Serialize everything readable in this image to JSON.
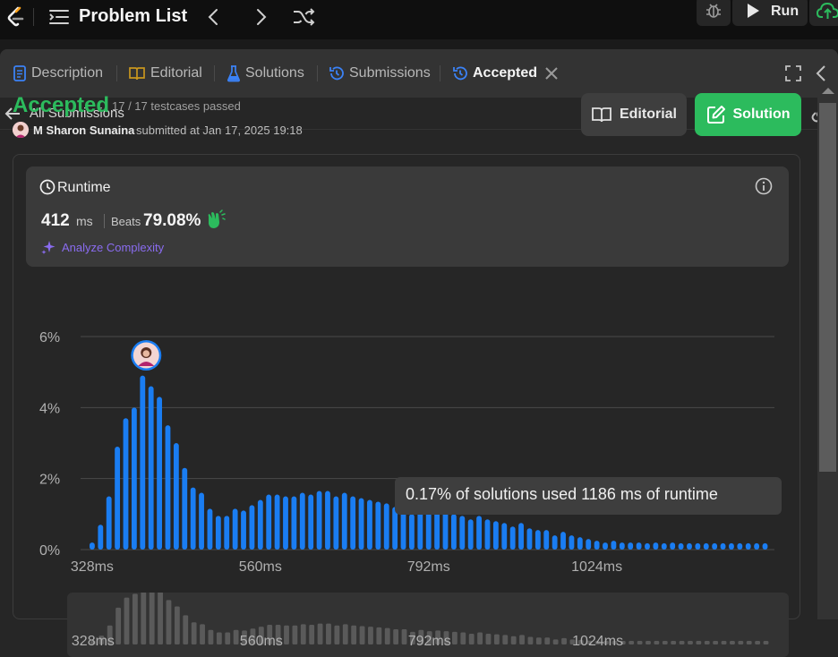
{
  "topbar": {
    "title": "Problem List",
    "run_label": "Run",
    "icons": [
      "leetcode-logo-icon",
      "list-icon",
      "chevron-left-icon",
      "chevron-right-icon",
      "shuffle-icon",
      "bug-icon",
      "play-icon",
      "cloud-upload-icon"
    ]
  },
  "tabs": [
    {
      "label": "Description",
      "icon": "description-icon"
    },
    {
      "label": "Editorial",
      "icon": "book-icon"
    },
    {
      "label": "Solutions",
      "icon": "flask-icon"
    },
    {
      "label": "Submissions",
      "icon": "history-icon"
    },
    {
      "label": "Accepted",
      "icon": "history-icon",
      "active": true
    }
  ],
  "subbar": {
    "back_label": "All Submissions"
  },
  "result": {
    "status": "Accepted",
    "testcases": "17 / 17 testcases passed",
    "author": "M Sharon Sunaina",
    "submitted": "submitted at Jan 17, 2025 19:18",
    "editorial_label": "Editorial",
    "solution_label": "Solution"
  },
  "runtime": {
    "title": "Runtime",
    "value": "412",
    "unit": "ms",
    "beats_label": "Beats",
    "beats_value": "79.08%",
    "analyze_label": "Analyze Complexity"
  },
  "tooltip": "0.17% of solutions used 1186 ms of runtime",
  "colors": {
    "accepted": "#2cbb5d",
    "bar": "#1a7df2",
    "analyze": "#8a6cf0",
    "brush_bar": "#5a5a5a"
  },
  "chart_data": {
    "type": "bar",
    "ylim": [
      0,
      6
    ],
    "yticks": [
      "6%",
      "4%",
      "2%",
      "0%"
    ],
    "xticks": [
      "328ms",
      "560ms",
      "792ms",
      "1024ms"
    ],
    "highlight_index": 6,
    "values": [
      0.2,
      0.7,
      1.5,
      2.9,
      3.7,
      4.0,
      4.9,
      4.6,
      4.3,
      3.5,
      3.0,
      2.3,
      1.75,
      1.6,
      1.15,
      0.95,
      0.95,
      1.15,
      1.1,
      1.25,
      1.4,
      1.55,
      1.55,
      1.5,
      1.5,
      1.6,
      1.55,
      1.65,
      1.65,
      1.5,
      1.6,
      1.5,
      1.45,
      1.4,
      1.35,
      1.3,
      1.2,
      1.2,
      1.0,
      1.15,
      1.05,
      1.1,
      1.05,
      1.0,
      0.95,
      0.85,
      0.95,
      0.85,
      0.8,
      0.75,
      0.65,
      0.75,
      0.6,
      0.55,
      0.55,
      0.4,
      0.5,
      0.4,
      0.35,
      0.3,
      0.25,
      0.2,
      0.25,
      0.2,
      0.2,
      0.2,
      0.18,
      0.2,
      0.18,
      0.2,
      0.18,
      0.18,
      0.18,
      0.18,
      0.18,
      0.18,
      0.18,
      0.18,
      0.18,
      0.18,
      0.18
    ]
  }
}
